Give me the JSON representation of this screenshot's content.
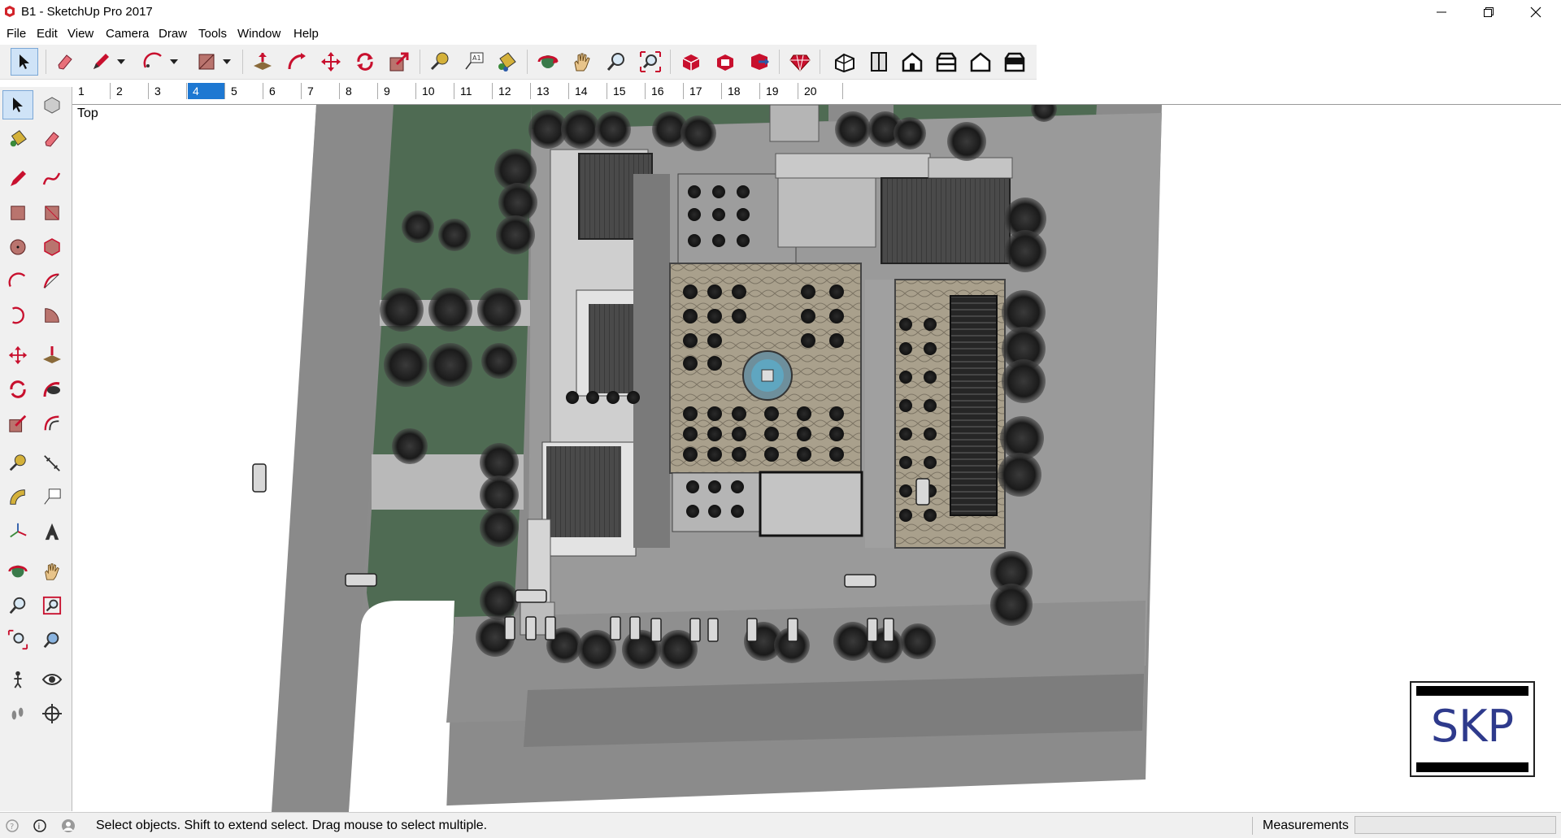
{
  "window": {
    "title": "B1 - SketchUp Pro 2017",
    "minimize_icon": "minimize-icon",
    "maximize_icon": "restore-icon",
    "close_icon": "close-icon"
  },
  "menu": {
    "items": [
      "File",
      "Edit",
      "View",
      "Camera",
      "Draw",
      "Tools",
      "Window",
      "Help"
    ]
  },
  "toolbar": {
    "tools": [
      "select",
      "eraser",
      "line",
      "arc",
      "rectangle",
      "push-pull",
      "follow-me",
      "move",
      "rotate",
      "scale",
      "tape-measure",
      "text",
      "paint-bucket",
      "orbit",
      "pan",
      "zoom",
      "zoom-extents",
      "warehouse",
      "extension-warehouse",
      "send-to-layout",
      "ruby",
      "iso-view",
      "top-view",
      "front-view",
      "right-view",
      "back-view",
      "left-view"
    ]
  },
  "scenes": {
    "tabs": [
      "1",
      "2",
      "3",
      "4",
      "5",
      "6",
      "7",
      "8",
      "9",
      "10",
      "11",
      "12",
      "13",
      "14",
      "15",
      "16",
      "17",
      "18",
      "19",
      "20"
    ],
    "selected": "4"
  },
  "viewport": {
    "view_label": "Top"
  },
  "badge": {
    "text": "SKP"
  },
  "status": {
    "message": "Select objects. Shift to extend select. Drag mouse to select multiple.",
    "measurements_label": "Measurements",
    "measurements_value": ""
  },
  "colors": {
    "accent": "#1e78d2",
    "tool_red": "#c8102e",
    "grass": "#4f6b53",
    "road": "#8c8c8c",
    "roof": "#4a4a4a"
  }
}
